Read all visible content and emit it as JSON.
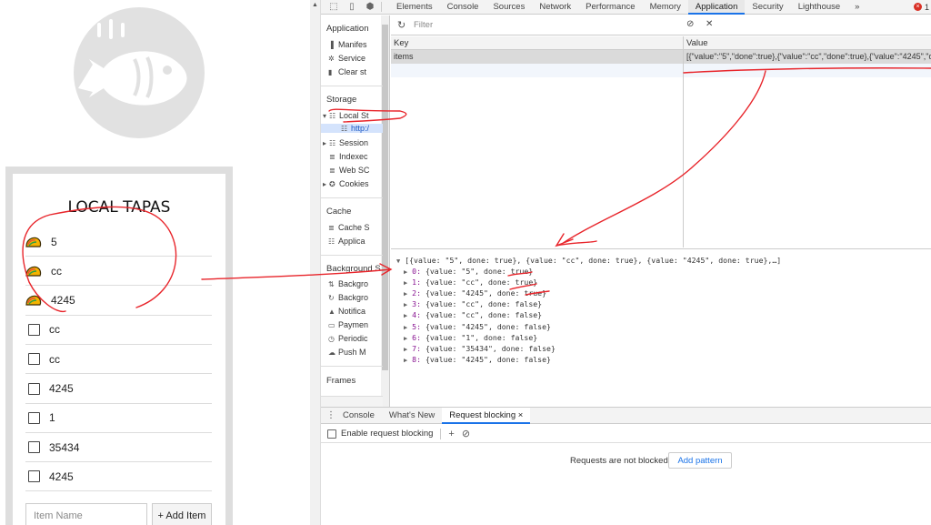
{
  "app": {
    "title": "LOCAL TAPAS",
    "items": [
      {
        "text": "5",
        "done": true
      },
      {
        "text": "cc",
        "done": true
      },
      {
        "text": "4245",
        "done": true
      },
      {
        "text": "cc",
        "done": false
      },
      {
        "text": "cc",
        "done": false
      },
      {
        "text": "4245",
        "done": false
      },
      {
        "text": "1",
        "done": false
      },
      {
        "text": "35434",
        "done": false
      },
      {
        "text": "4245",
        "done": false
      }
    ],
    "input_placeholder": "Item Name",
    "add_label": "+ Add Item",
    "done_icon": "taco-icon",
    "logo_icon": "fish-icon"
  },
  "devtools": {
    "tabs": [
      "Elements",
      "Console",
      "Sources",
      "Network",
      "Performance",
      "Memory",
      "Application",
      "Security",
      "Lighthouse"
    ],
    "active_tab": "Application",
    "more_tabs": "»",
    "error_count": "1",
    "sidebar": {
      "application_header": "Application",
      "application_items": [
        "Manifes",
        "Service",
        "Clear st"
      ],
      "storage_header": "Storage",
      "local_storage": "Local St",
      "local_storage_origin": "http:/",
      "storage_items": [
        "Session",
        "Indexec",
        "Web SC",
        "Cookies"
      ],
      "cache_header": "Cache",
      "cache_items": [
        "Cache S",
        "Applica"
      ],
      "background_header": "Background S",
      "background_items": [
        "Backgro",
        "Backgro",
        "Notifica",
        "Paymen",
        "Periodic",
        "Push M"
      ],
      "frames_header": "Frames"
    },
    "filter_placeholder": "Filter",
    "table": {
      "key_header": "Key",
      "value_header": "Value",
      "row_key": "items",
      "row_value": "[{\"value\":\"5\",\"done\":true},{\"value\":\"cc\",\"done\":true},{\"value\":\"4245\",\"d"
    },
    "preview": {
      "summary": "[{value: \"5\", done: true}, {value: \"cc\", done: true}, {value: \"4245\", done: true},…]",
      "lines": [
        {
          "idx": "0:",
          "text": "{value: \"5\", done: true}"
        },
        {
          "idx": "1:",
          "text": "{value: \"cc\", done: true}"
        },
        {
          "idx": "2:",
          "text": "{value: \"4245\", done: true}"
        },
        {
          "idx": "3:",
          "text": "{value: \"cc\", done: false}"
        },
        {
          "idx": "4:",
          "text": "{value: \"cc\", done: false}"
        },
        {
          "idx": "5:",
          "text": "{value: \"4245\", done: false}"
        },
        {
          "idx": "6:",
          "text": "{value: \"1\", done: false}"
        },
        {
          "idx": "7:",
          "text": "{value: \"35434\", done: false}"
        },
        {
          "idx": "8:",
          "text": "{value: \"4245\", done: false}"
        }
      ]
    },
    "drawer": {
      "tabs": [
        "Console",
        "What's New",
        "Request blocking"
      ],
      "active_tab": "Request blocking",
      "enable_label": "Enable request blocking",
      "not_blocked": "Requests are not blocked.",
      "add_pattern": "Add pattern"
    }
  },
  "colors": {
    "accent": "#1a73e8",
    "annotation": "#e8252b",
    "logo": "#e0e0e0"
  }
}
